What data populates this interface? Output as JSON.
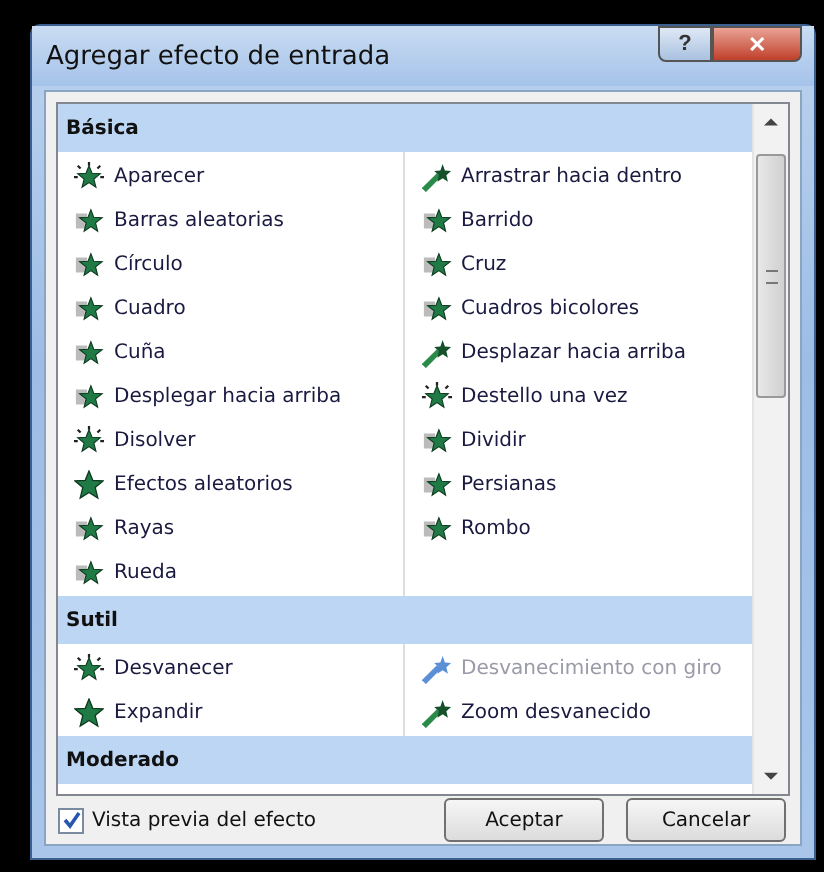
{
  "window": {
    "title": "Agregar efecto de entrada",
    "controls": [
      "?",
      "✕"
    ]
  },
  "sections": [
    {
      "title": "Básica",
      "items": [
        {
          "label": "Aparecer",
          "kind": "burst",
          "disabled": false
        },
        {
          "label": "Arrastrar hacia dentro",
          "kind": "motion",
          "disabled": false
        },
        {
          "label": "Barras aleatorias",
          "kind": "star",
          "disabled": false
        },
        {
          "label": "Barrido",
          "kind": "star",
          "disabled": false
        },
        {
          "label": "Círculo",
          "kind": "star",
          "disabled": false
        },
        {
          "label": "Cruz",
          "kind": "star",
          "disabled": false
        },
        {
          "label": "Cuadro",
          "kind": "star",
          "disabled": false
        },
        {
          "label": "Cuadros bicolores",
          "kind": "star",
          "disabled": false
        },
        {
          "label": "Cuña",
          "kind": "star",
          "disabled": false
        },
        {
          "label": "Desplazar hacia arriba",
          "kind": "motion",
          "disabled": false
        },
        {
          "label": "Desplegar hacia arriba",
          "kind": "star",
          "disabled": false
        },
        {
          "label": "Destello una vez",
          "kind": "burst",
          "disabled": false
        },
        {
          "label": "Disolver",
          "kind": "burst",
          "disabled": false
        },
        {
          "label": "Dividir",
          "kind": "star",
          "disabled": false
        },
        {
          "label": "Efectos aleatorios",
          "kind": "big",
          "disabled": false
        },
        {
          "label": "Persianas",
          "kind": "star",
          "disabled": false
        },
        {
          "label": "Rayas",
          "kind": "star",
          "disabled": false
        },
        {
          "label": "Rombo",
          "kind": "star",
          "disabled": false
        },
        {
          "label": "Rueda",
          "kind": "star",
          "disabled": false
        }
      ]
    },
    {
      "title": "Sutil",
      "items": [
        {
          "label": "Desvanecer",
          "kind": "burst",
          "disabled": false
        },
        {
          "label": "Desvanecimiento con giro",
          "kind": "motion",
          "disabled": true
        },
        {
          "label": "Expandir",
          "kind": "big",
          "disabled": false
        },
        {
          "label": "Zoom desvanecido",
          "kind": "motion",
          "disabled": false
        }
      ]
    },
    {
      "title": "Moderado"
    }
  ],
  "preview": {
    "label": "Vista previa del efecto",
    "checked": true
  },
  "buttons": [
    "Aceptar",
    "Cancelar"
  ]
}
